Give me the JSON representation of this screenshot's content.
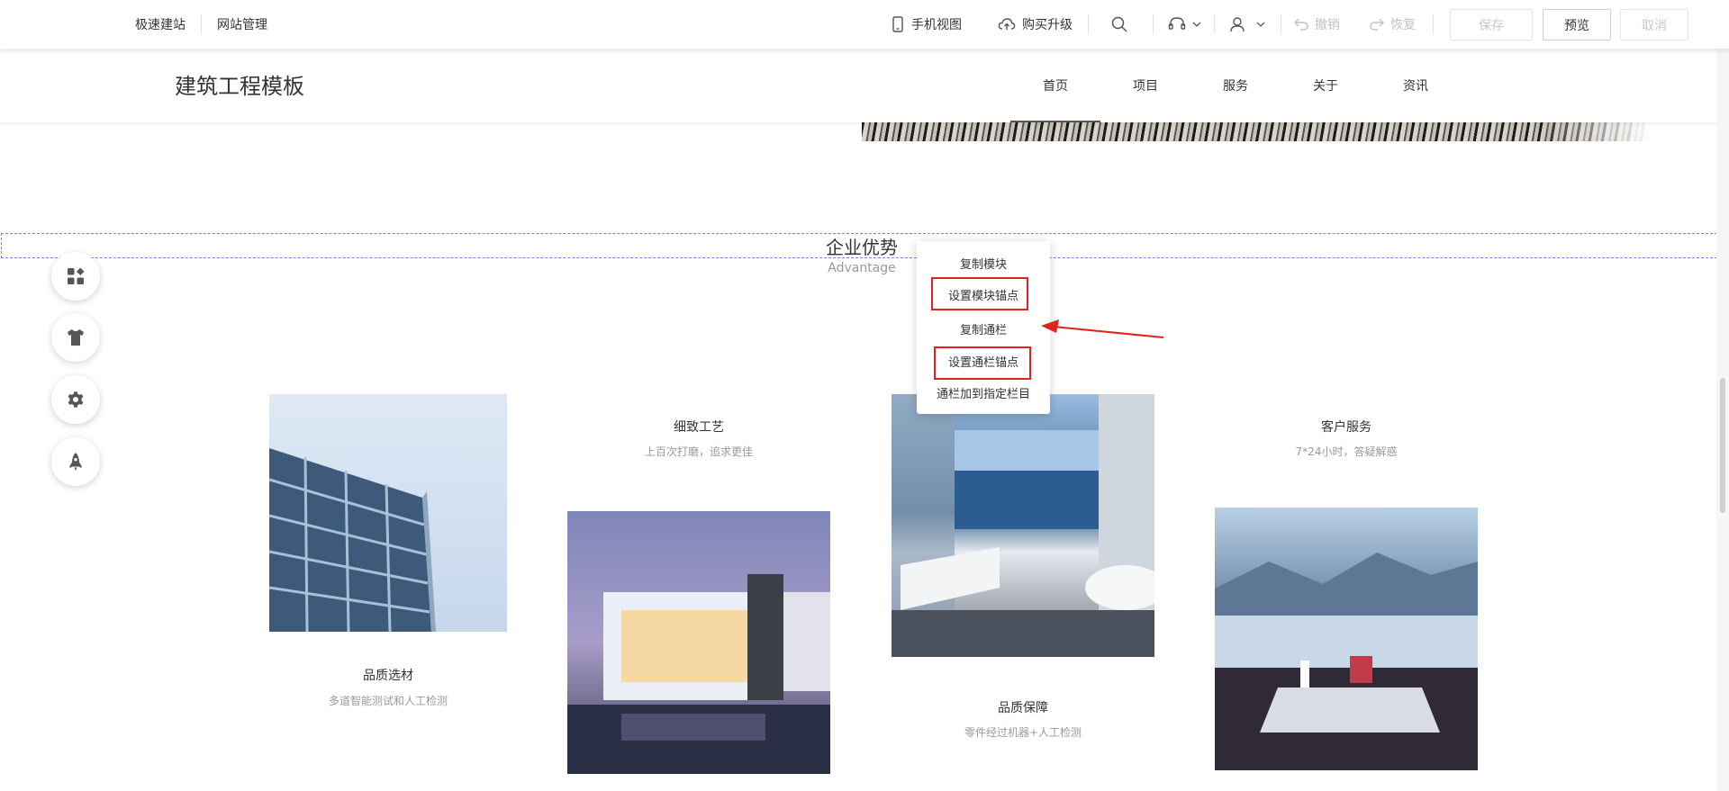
{
  "toolbar": {
    "left_items": [
      "极速建站",
      "网站管理"
    ],
    "mobile_view": "手机视图",
    "buy_upgrade": "购买升级",
    "undo": "撤销",
    "redo": "恢复",
    "save": "保存",
    "preview": "预览",
    "cancel": "取消"
  },
  "site": {
    "title": "建筑工程模板",
    "nav": [
      "首页",
      "项目",
      "服务",
      "关于",
      "资讯"
    ],
    "active_nav": "首页"
  },
  "section": {
    "title": "企业优势",
    "subtitle": "Advantage"
  },
  "context_menu": {
    "items": [
      "复制模块",
      "设置模块锚点",
      "复制通栏",
      "设置通栏锚点",
      "通栏加到指定栏目"
    ],
    "highlighted": [
      "设置模块锚点",
      "设置通栏锚点"
    ]
  },
  "features": [
    {
      "title": "品质选材",
      "subtitle": "多道智能测试和人工检测"
    },
    {
      "title": "细致工艺",
      "subtitle": "上百次打磨，追求更佳"
    },
    {
      "title": "品质保障",
      "subtitle": "零件经过机器+人工检测"
    },
    {
      "title": "客户服务",
      "subtitle": "7*24小时，答疑解惑"
    }
  ],
  "float_tools": [
    "apps-add-icon",
    "tshirt-icon",
    "gear-icon",
    "rocket-icon"
  ],
  "colors": {
    "highlight_red": "#e0231f",
    "selection_blue": "#6c8be0"
  }
}
